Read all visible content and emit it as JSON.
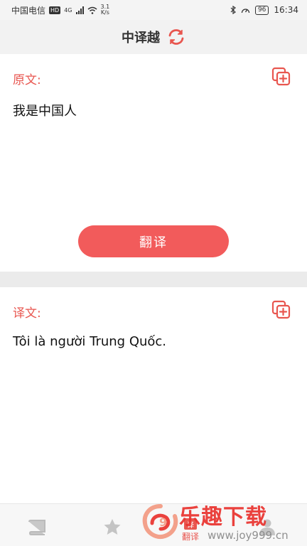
{
  "status_bar": {
    "carrier": "中国电信",
    "network_badge": "HD",
    "network_type": "4G",
    "speed_value": "3.1",
    "speed_unit": "K/s",
    "battery": "96",
    "time": "16:34"
  },
  "header": {
    "title": "中译越",
    "swap_icon": "refresh-swap-icon"
  },
  "source": {
    "label": "原文:",
    "text": "我是中国人",
    "copy_icon": "copy-add-icon"
  },
  "translate_button": {
    "label": "翻译"
  },
  "target": {
    "label": "译文:",
    "text": "Tôi là người Trung Quốc.",
    "copy_icon": "copy-add-icon"
  },
  "bottom_nav": {
    "items": [
      {
        "icon": "book-icon",
        "label": ""
      },
      {
        "icon": "star-icon",
        "label": ""
      },
      {
        "icon": "translate-icon",
        "badge": "译",
        "label": "翻译"
      },
      {
        "icon": "user-icon",
        "label": ""
      }
    ]
  },
  "watermark": {
    "brand": "乐趣下载",
    "url": "www.joy999.cn"
  },
  "colors": {
    "accent": "#e8564f",
    "button": "#f25b5b",
    "header_bg": "#f2f2f2"
  }
}
